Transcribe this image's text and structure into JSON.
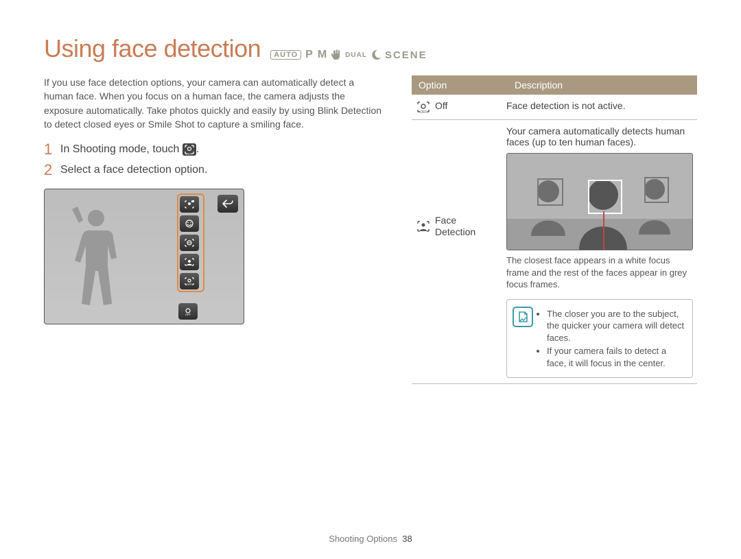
{
  "title": "Using face detection",
  "modes": {
    "auto": "AUTO",
    "p": "P",
    "m": "M",
    "dual": "DUAL",
    "scene": "SCENE"
  },
  "intro": "If you use face detection options, your camera can automatically detect a human face. When you focus on a human face, the camera adjusts the exposure automatically. Take photos quickly and easily by using Blink Detection to detect closed eyes or Smile Shot to capture a smiling face.",
  "steps": [
    {
      "num": "1",
      "text_before": "In Shooting mode, touch ",
      "text_after": "."
    },
    {
      "num": "2",
      "text": "Select a face detection option."
    }
  ],
  "table": {
    "headers": {
      "option": "Option",
      "description": "Description"
    },
    "rows": [
      {
        "label": "Off",
        "desc": "Face detection is not active."
      },
      {
        "label_line1": "Face",
        "label_line2": "Detection",
        "desc_top": "Your camera automatically detects human faces (up to ten human faces).",
        "caption": "The closest face appears in a white focus frame and the rest of the faces appear in grey focus frames.",
        "notes": [
          "The closer you are to the subject, the quicker your camera will detect faces.",
          "If your camera fails to detect a face, it will focus in the center."
        ]
      }
    ]
  },
  "footer": {
    "section": "Shooting Options",
    "page": "38"
  }
}
